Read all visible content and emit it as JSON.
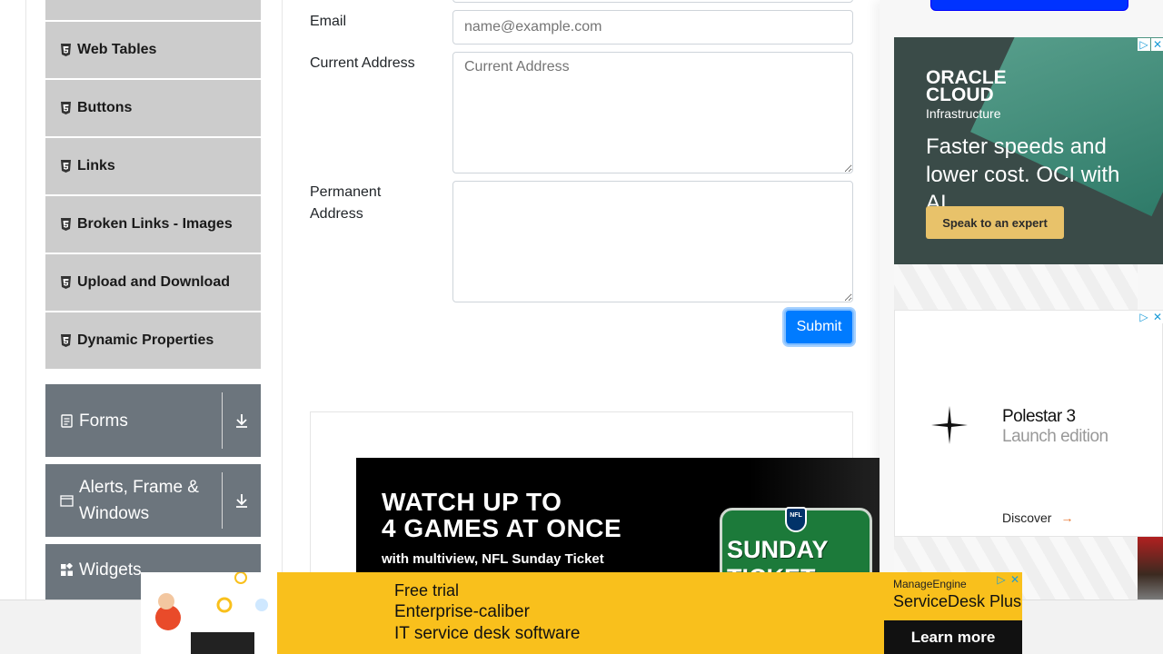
{
  "sidebar": {
    "items": [
      {
        "label": "Web Tables"
      },
      {
        "label": "Buttons"
      },
      {
        "label": "Links"
      },
      {
        "label": "Broken Links - Images"
      },
      {
        "label": "Upload and Download"
      },
      {
        "label": "Dynamic Properties"
      }
    ],
    "groups": [
      {
        "label": "Forms"
      },
      {
        "label": "Alerts, Frame & Windows"
      },
      {
        "label": "Widgets"
      }
    ]
  },
  "form": {
    "email_label": "Email",
    "email_placeholder": "name@example.com",
    "current_address_label": "Current Address",
    "current_address_placeholder": "Current Address",
    "permanent_address_label": "Permanent Address",
    "submit_label": "Submit"
  },
  "ads": {
    "nfl": {
      "headline_1": "WATCH UP TO",
      "headline_2": "4 GAMES AT ONCE",
      "subline": "with multiview, NFL Sunday Ticket",
      "badge": "NFL",
      "logo_text": "SUNDAY TICKET"
    },
    "oracle": {
      "brand": "ORACLE",
      "brand_2": "CLOUD",
      "brand_sub": "Infrastructure",
      "tagline": "Faster speeds and lower cost. OCI with AI.",
      "cta": "Speak to an expert"
    },
    "polestar": {
      "name": "Polestar 3",
      "edition": "Launch edition",
      "cta": "Discover"
    },
    "manageengine": {
      "line_1": "Free trial",
      "line_2": "Enterprise-caliber",
      "line_3": "IT service desk software",
      "brand": "ManageEngine",
      "product": "ServiceDesk Plus",
      "cta": "Learn more"
    }
  },
  "colors": {
    "primary": "#007bff",
    "sidebar_item_bg": "#cccccc",
    "sidebar_group_bg": "#6c757d"
  }
}
